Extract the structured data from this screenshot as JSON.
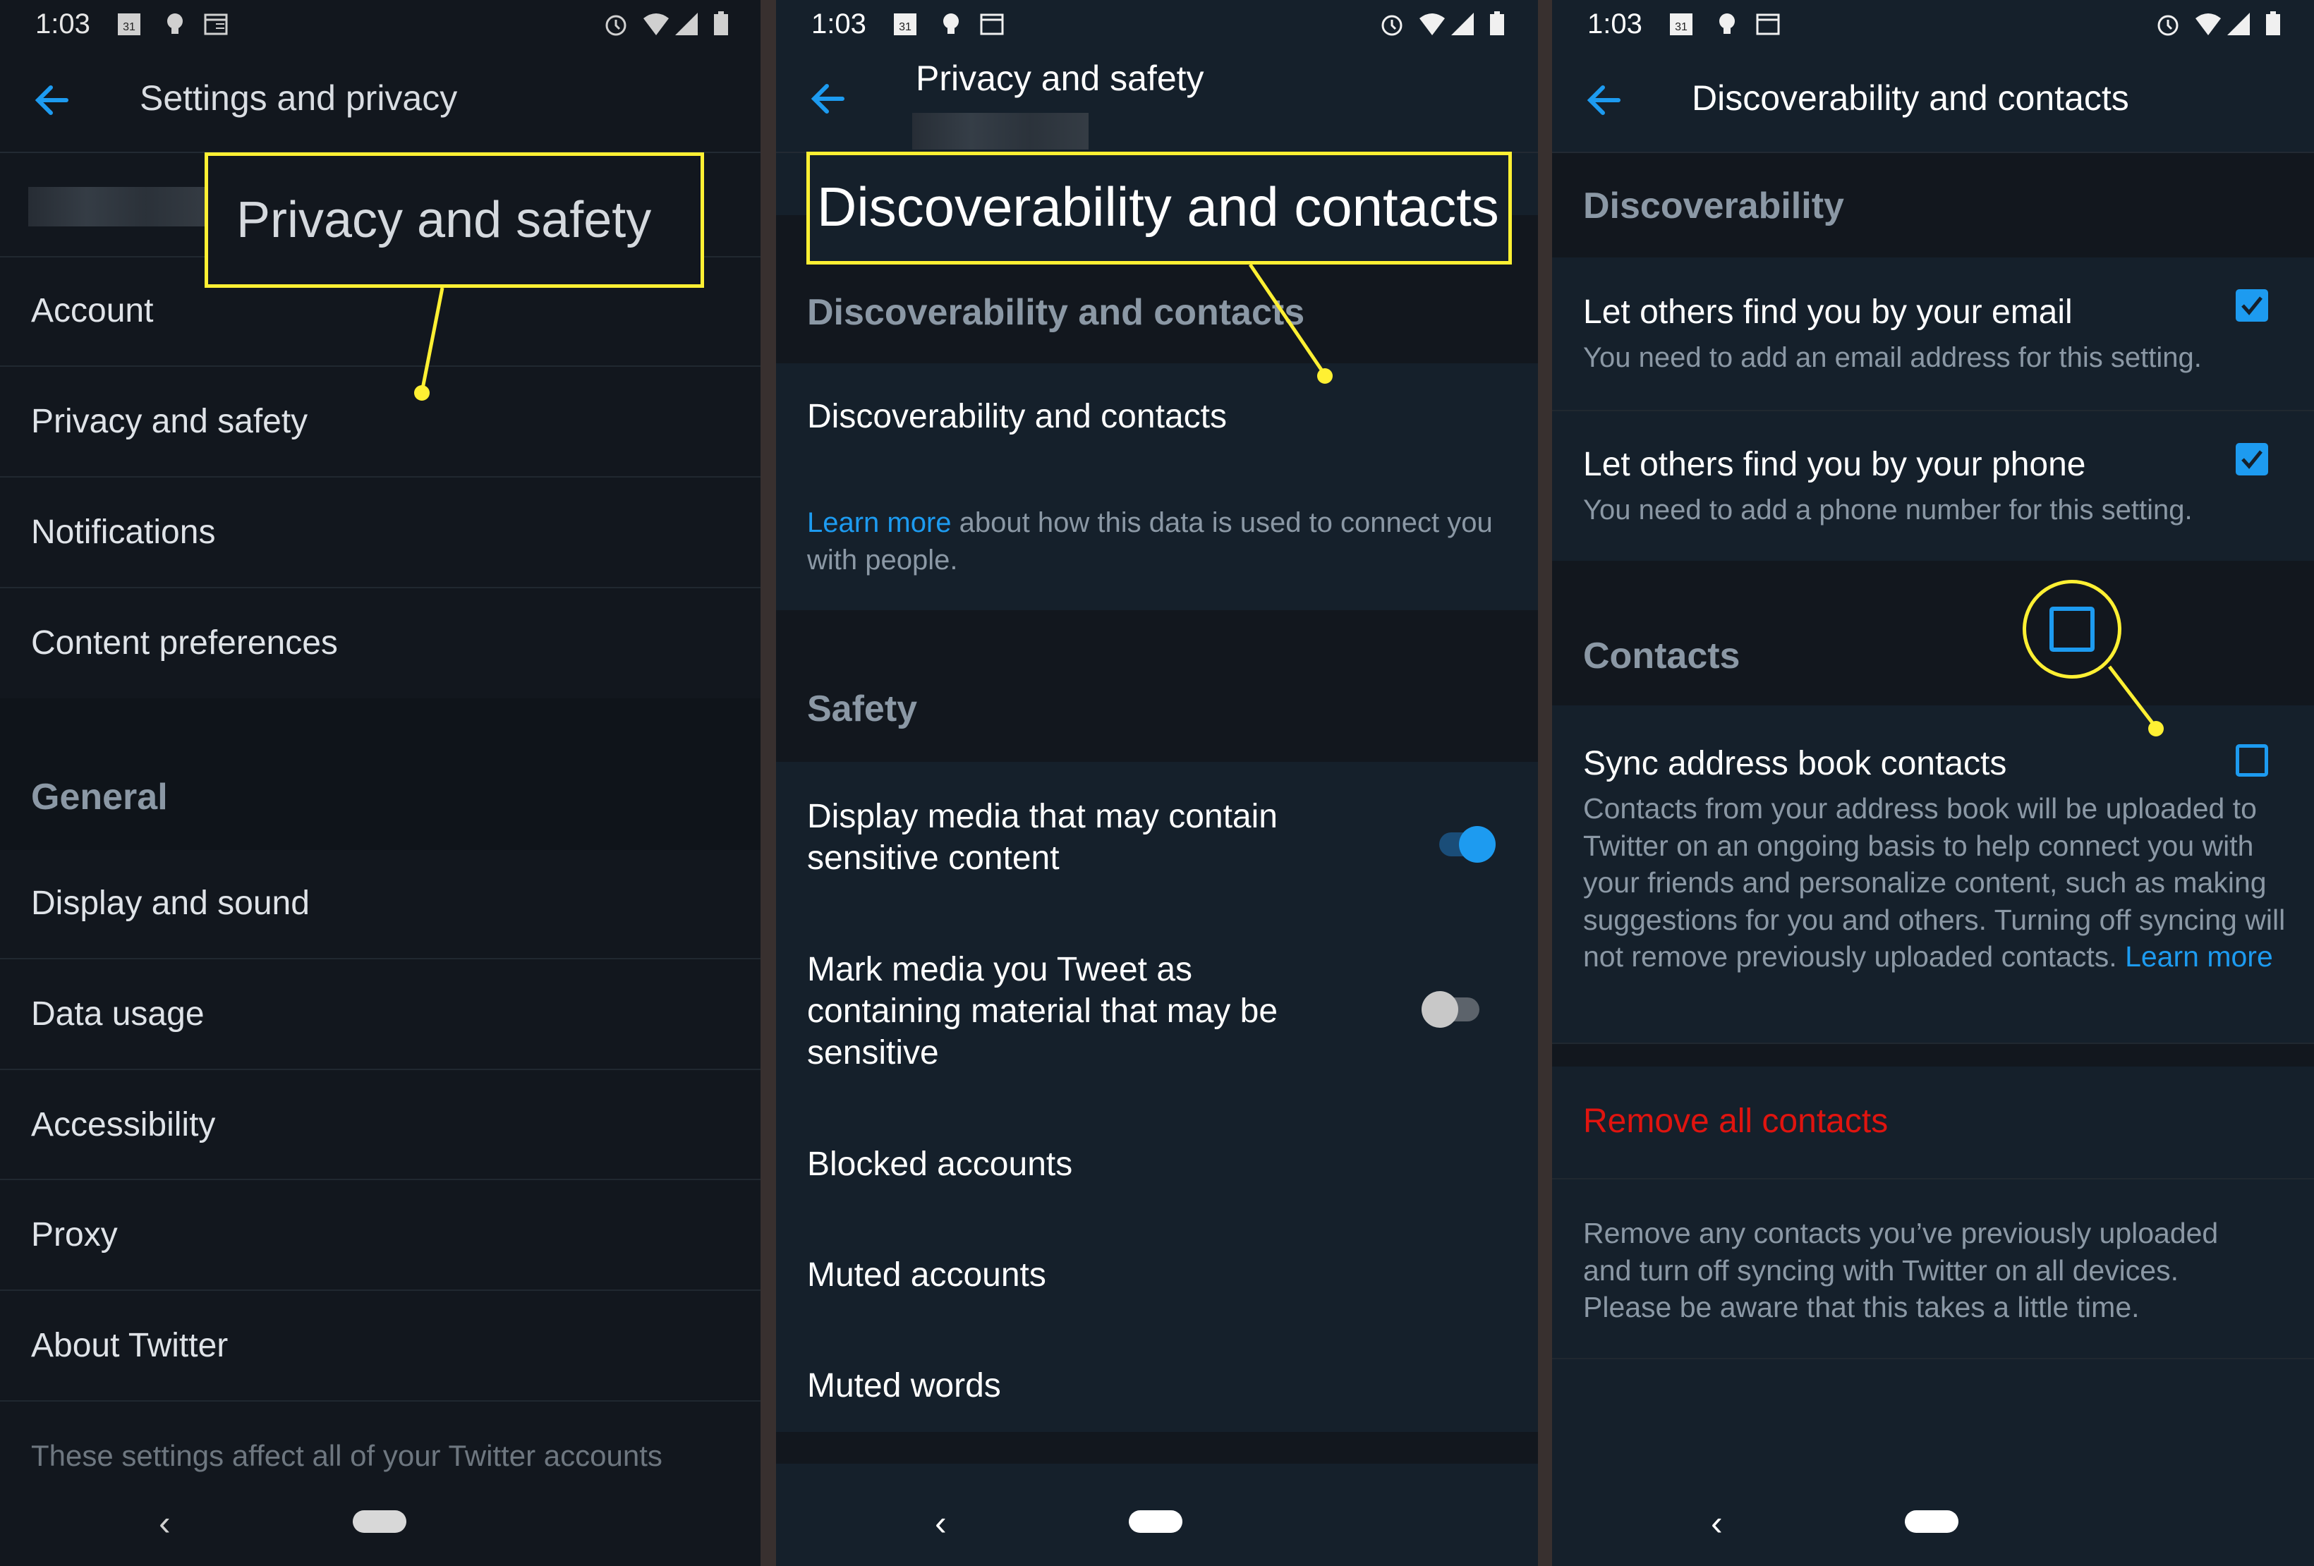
{
  "status_bar": {
    "time": "1:03",
    "calendar_date": "31"
  },
  "panels": [
    {
      "header_title": "Settings and privacy",
      "callout_label": "Privacy and safety",
      "items": [
        "Account",
        "Privacy and safety",
        "Notifications",
        "Content preferences"
      ],
      "general_section": "General",
      "general_items": [
        "Display and sound",
        "Data usage",
        "Accessibility",
        "Proxy",
        "About Twitter"
      ],
      "footer_note": "These settings affect all of your Twitter accounts"
    },
    {
      "header_title": "Privacy and safety",
      "callout_label": "Discoverability and contacts",
      "discover_section": "Discoverability and contacts",
      "discover_item": "Discoverability and contacts",
      "learn_more_link": "Learn more",
      "learn_more_rest": " about how this data is used to connect you with people.",
      "safety_section": "Safety",
      "toggles": [
        {
          "label": "Display media that may contain sensitive content",
          "on": true
        },
        {
          "label": "Mark media you Tweet as containing material that may be sensitive",
          "on": false
        }
      ],
      "safety_items": [
        "Blocked accounts",
        "Muted accounts",
        "Muted words"
      ]
    },
    {
      "header_title": "Discoverability and contacts",
      "discover_section": "Discoverability",
      "checks": [
        {
          "label": "Let others find you by your email",
          "sub": "You need to add an email address for this setting.",
          "checked": true
        },
        {
          "label": "Let others find you by your phone",
          "sub": "You need to add a phone number for this setting.",
          "checked": true
        }
      ],
      "contacts_section": "Contacts",
      "sync": {
        "label": "Sync address book contacts",
        "checked": false,
        "desc": "Contacts from your address book will be uploaded to Twitter on an ongoing basis to help connect you with your friends and personalize content, such as making suggestions for you and others. Turning off syncing will not remove previously uploaded contacts.",
        "link": "Learn more"
      },
      "remove_label": "Remove all contacts",
      "remove_desc": "Remove any contacts you’ve previously uploaded and turn off syncing with Twitter on all devices. Please be aware that this takes a little time."
    }
  ],
  "colors": {
    "accent": "#1d9bf0",
    "annotation": "#fff033",
    "danger": "#e0140f"
  }
}
